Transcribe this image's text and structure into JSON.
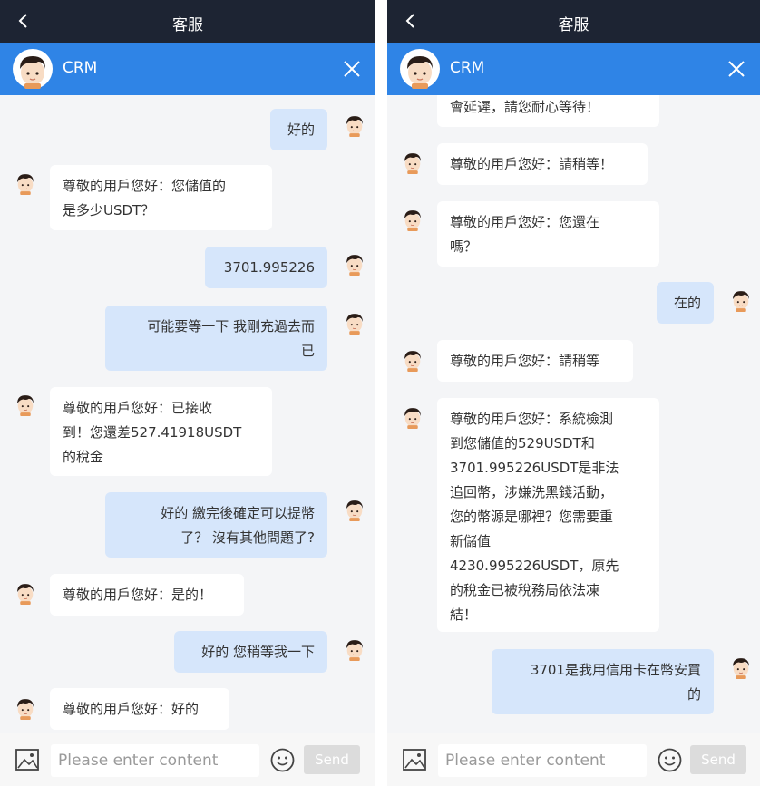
{
  "app": {
    "title": "客服",
    "agent_name": "CRM"
  },
  "input": {
    "placeholder": "Please enter content",
    "send_label": "Send"
  },
  "colors": {
    "header": "#1d2433",
    "crm_bar": "#2f84e6",
    "outgoing_bubble": "#d6e6fb",
    "incoming_bubble": "#ffffff"
  },
  "left_chat": {
    "messages": [
      {
        "from": "user",
        "text": "好的"
      },
      {
        "from": "agent",
        "text": "尊敬的用戶您好：您儲值的\n是多少USDT？"
      },
      {
        "from": "user",
        "text": "3701.995226"
      },
      {
        "from": "user",
        "text": "可能要等一下 我剛充過去而\n已"
      },
      {
        "from": "agent",
        "text": "尊敬的用戶您好：已接收\n到！您還差527.41918USDT\n的稅金"
      },
      {
        "from": "user",
        "text": "好的 繳完後確定可以提幣\n了？ 沒有其他問題了?"
      },
      {
        "from": "agent",
        "text": "尊敬的用戶您好：是的！"
      },
      {
        "from": "user",
        "text": "好的 您稍等我一下"
      },
      {
        "from": "agent",
        "text": "尊敬的用戶您好：好的"
      }
    ]
  },
  "right_chat": {
    "messages": [
      {
        "from": "agent",
        "text": "會延遲，請您耐心等待！"
      },
      {
        "from": "agent",
        "text": "尊敬的用戶您好：請稍等！"
      },
      {
        "from": "agent",
        "text": "尊敬的用戶您好：您還在\n嗎？"
      },
      {
        "from": "user",
        "text": "在的"
      },
      {
        "from": "agent",
        "text": "尊敬的用戶您好：請稍等"
      },
      {
        "from": "agent",
        "text": "尊敬的用戶您好：系統檢測\n到您儲值的529USDT和\n3701.995226USDT是非法\n追回幣，涉嫌洗黑錢活動，\n您的幣源是哪裡？您需要重\n新儲值\n4230.995226USDT，原先\n的稅金已被稅務局依法凍\n結！"
      },
      {
        "from": "user",
        "text": "3701是我用信用卡在幣安買\n的"
      }
    ]
  }
}
